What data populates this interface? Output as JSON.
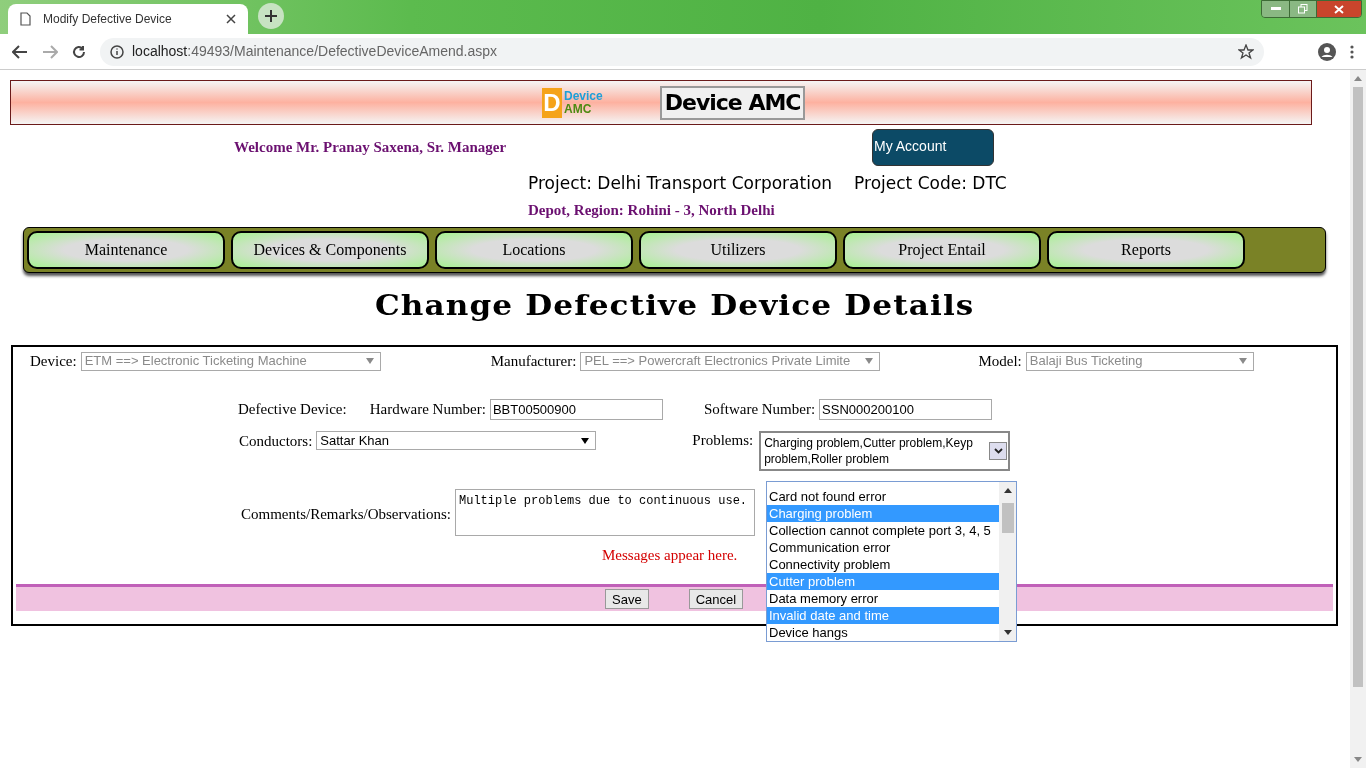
{
  "browser": {
    "tab_title": "Modify Defective Device",
    "url_host": "localhost",
    "url_path": ":49493/Maintenance/DefectiveDeviceAmend.aspx"
  },
  "header": {
    "logo": {
      "letter": "D",
      "top": "Device",
      "bottom": "AMC"
    },
    "title": "Device AMC",
    "welcome": "Welcome Mr. Pranay Saxena, Sr. Manager",
    "account_button": "My Account",
    "project": "Project: Delhi Transport Corporation",
    "project_code": "Project Code: DTC",
    "depot": "Depot, Region: Rohini - 3, North Delhi"
  },
  "nav": {
    "items": [
      "Maintenance",
      "Devices & Components",
      "Locations",
      "Utilizers",
      "Project Entail",
      "Reports"
    ]
  },
  "page_title": "Change Defective Device Details",
  "form": {
    "device": {
      "label": "Device:",
      "value": "ETM ==> Electronic Ticketing Machine",
      "disabled": true
    },
    "manufacturer": {
      "label": "Manufacturer:",
      "value": "PEL ==> Powercraft Electronics Private Limite",
      "disabled": true
    },
    "model": {
      "label": "Model:",
      "value": "Balaji Bus Ticketing",
      "disabled": true
    },
    "defective_device_label": "Defective Device:",
    "hardware_number": {
      "label": "Hardware Number:",
      "value": "BBT00500900"
    },
    "software_number": {
      "label": "Software Number:",
      "value": "SSN000200100"
    },
    "conductors": {
      "label": "Conductors:",
      "value": "Sattar Khan",
      "disabled": false
    },
    "problems": {
      "label": "Problems:",
      "value_lines": [
        "Charging problem,Cutter problem,Keyp",
        "problem,Roller problem"
      ],
      "expanded": true,
      "options": [
        {
          "text": "Card not found error",
          "selected": false
        },
        {
          "text": "Charging problem",
          "selected": true
        },
        {
          "text": "Collection cannot complete port 3, 4, 5",
          "selected": false
        },
        {
          "text": "Communication error",
          "selected": false
        },
        {
          "text": "Connectivity problem",
          "selected": false
        },
        {
          "text": "Cutter problem",
          "selected": true
        },
        {
          "text": "Data memory error",
          "selected": false
        },
        {
          "text": "Invalid date and time",
          "selected": true
        },
        {
          "text": "Device hangs",
          "selected": false
        }
      ]
    },
    "comments": {
      "label": "Comments/Remarks/Observations:",
      "value": "Multiple problems due to continuous use."
    },
    "message": "Messages appear here.",
    "buttons": [
      "Save",
      "Cancel"
    ]
  }
}
